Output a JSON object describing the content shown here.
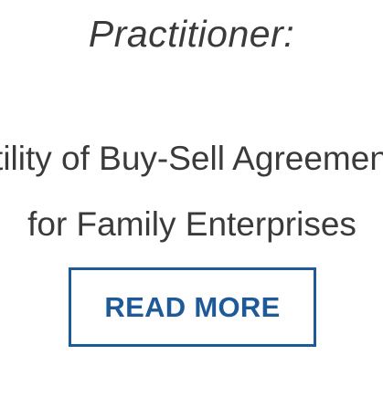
{
  "card": {
    "category": "Practitioner:",
    "title_lines": [
      "Utility of Buy-Sell Agreements",
      "for Family Enterprises"
    ],
    "read_more_label": "READ MORE"
  },
  "colors": {
    "accent": "#1f5a98",
    "text": "#3a3a3a",
    "background": "#ffffff"
  }
}
